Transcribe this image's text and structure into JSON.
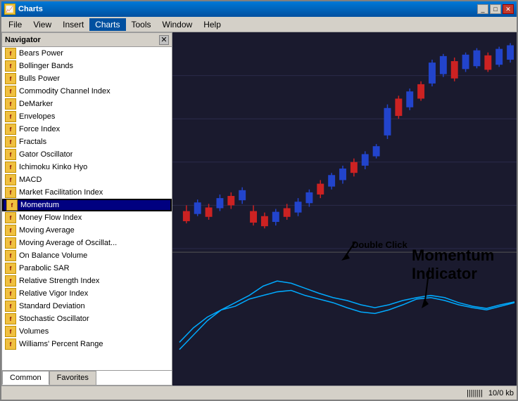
{
  "window": {
    "title": "Charts",
    "icon": "chart-icon"
  },
  "menu": {
    "items": [
      "File",
      "View",
      "Insert",
      "Charts",
      "Tools",
      "Window",
      "Help"
    ],
    "active": "Charts"
  },
  "navigator": {
    "title": "Navigator",
    "indicators": [
      "Bears Power",
      "Bollinger Bands",
      "Bulls Power",
      "Commodity Channel Index",
      "DeMarker",
      "Envelopes",
      "Force Index",
      "Fractals",
      "Gator Oscillator",
      "Ichimoku Kinko Hyo",
      "MACD",
      "Market Facilitation Index",
      "Momentum",
      "Money Flow Index",
      "Moving Average",
      "Moving Average of Oscillat...",
      "On Balance Volume",
      "Parabolic SAR",
      "Relative Strength Index",
      "Relative Vigor Index",
      "Standard Deviation",
      "Stochastic Oscillator",
      "Volumes",
      "Williams' Percent Range"
    ],
    "selected_index": 12,
    "tabs": [
      "Common",
      "Favorites"
    ]
  },
  "annotations": {
    "double_click": "Double Click",
    "momentum_indicator": "Momentum Indicator"
  },
  "status_bar": {
    "chart_icon": "||||||||",
    "info": "10/0 kb"
  }
}
